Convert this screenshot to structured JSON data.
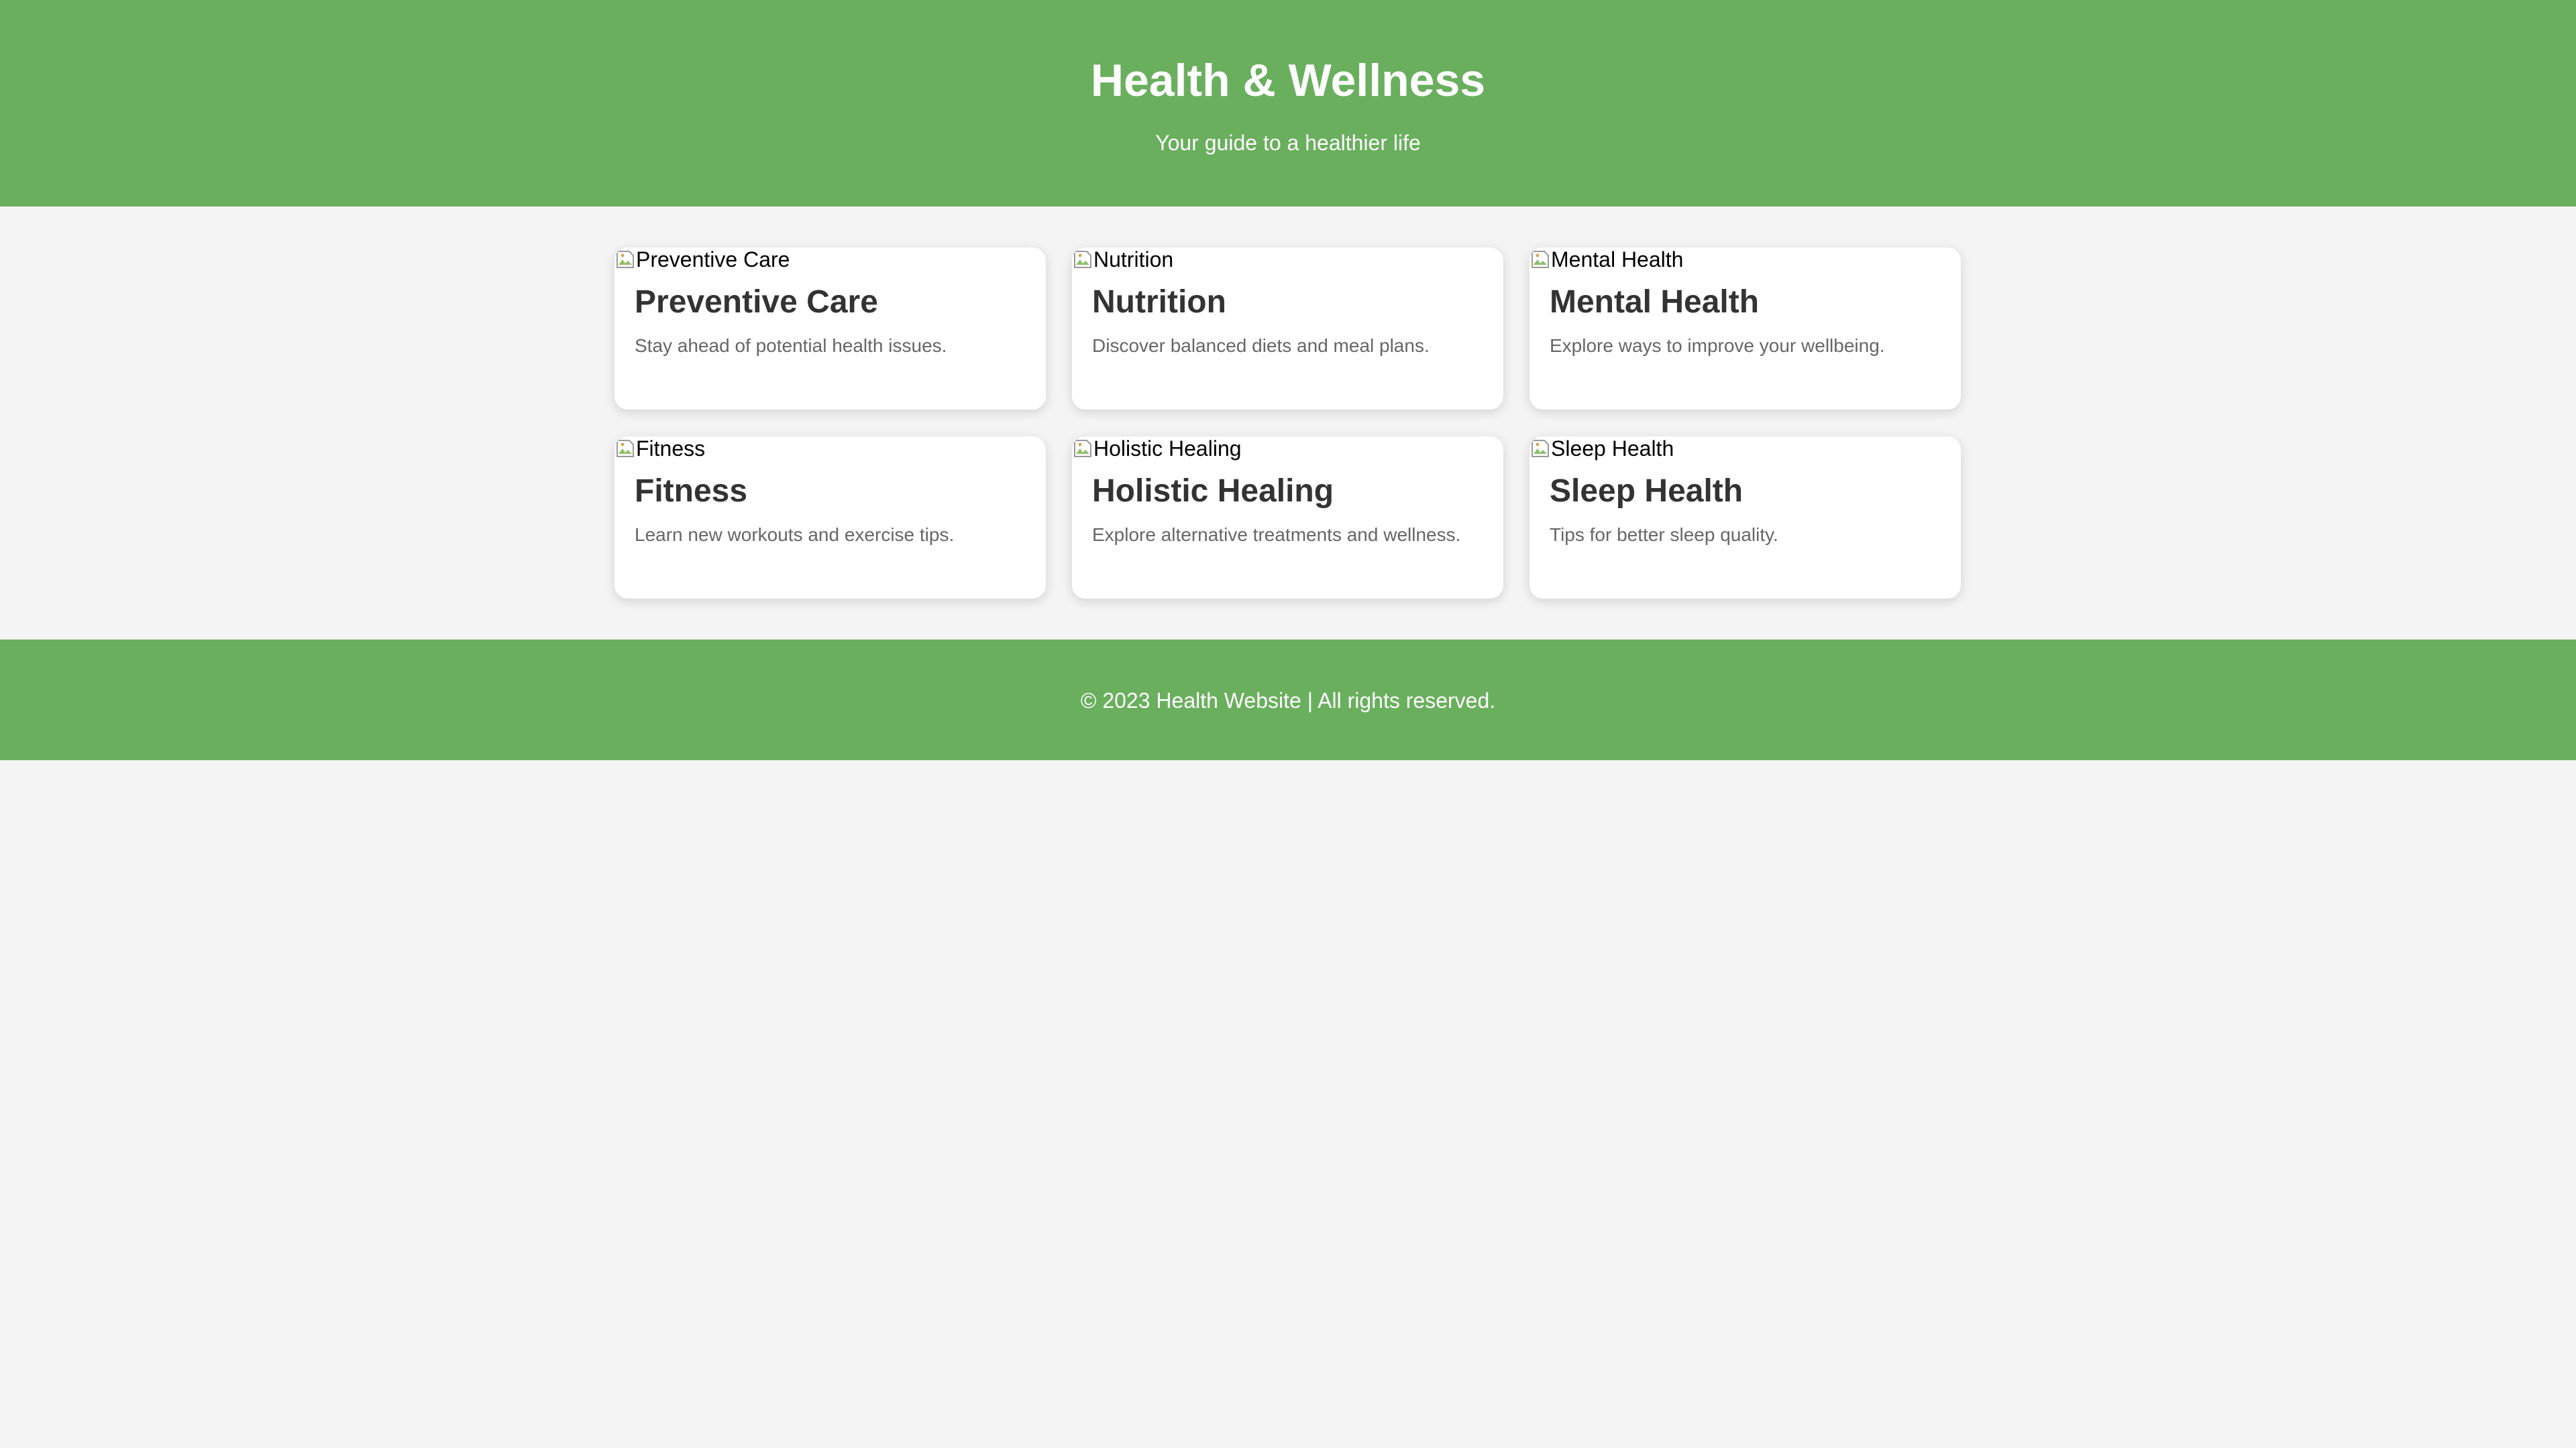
{
  "header": {
    "title": "Health & Wellness",
    "subtitle": "Your guide to a healthier life"
  },
  "cards": [
    {
      "image_alt": "Preventive Care",
      "title": "Preventive Care",
      "description": "Stay ahead of potential health issues."
    },
    {
      "image_alt": "Nutrition",
      "title": "Nutrition",
      "description": "Discover balanced diets and meal plans."
    },
    {
      "image_alt": "Mental Health",
      "title": "Mental Health",
      "description": "Explore ways to improve your wellbeing."
    },
    {
      "image_alt": "Fitness",
      "title": "Fitness",
      "description": "Learn new workouts and exercise tips."
    },
    {
      "image_alt": "Holistic Healing",
      "title": "Holistic Healing",
      "description": "Explore alternative treatments and wellness."
    },
    {
      "image_alt": "Sleep Health",
      "title": "Sleep Health",
      "description": "Tips for better sleep quality."
    }
  ],
  "footer": {
    "text": "© 2023 Health Website | All rights reserved."
  },
  "colors": {
    "brand_green": "#6aaf5e",
    "page_background": "#f4f4f4",
    "card_background": "#ffffff",
    "title_text": "#333333",
    "description_text": "#666666"
  },
  "icons": {
    "card_image": "broken-image-icon"
  }
}
